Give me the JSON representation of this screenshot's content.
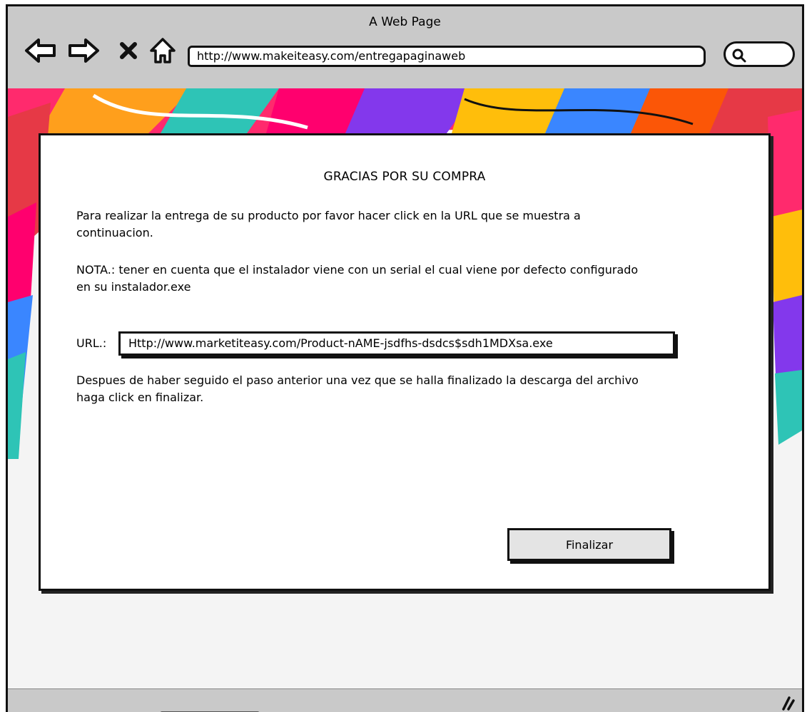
{
  "window": {
    "title": "A Web Page",
    "url": "http://www.makeiteasy.com/entregapaginaweb"
  },
  "icons": {
    "back": "arrow-left-icon",
    "forward": "arrow-right-icon",
    "stop": "close-icon",
    "home": "home-icon",
    "search": "search-icon",
    "resize": "resize-grip-icon"
  },
  "content": {
    "heading": "GRACIAS POR SU COMPRA",
    "paragraph1": "Para realizar la entrega de su producto por favor hacer click en la URL que se muestra a continuacion.",
    "paragraph2": "NOTA.: tener en cuenta que el instalador viene con un serial el cual viene por defecto configurado en su instalador.exe",
    "url_label": "URL.:",
    "download_url": "Http://www.marketiteasy.com/Product-nAME-jsdfhs-dsdcs$sdh1MDXsa.exe",
    "paragraph3": "Despues de haber seguido el paso anterior una vez que se halla finalizado la descarga del archivo haga click en finalizar.",
    "finish_label": "Finalizar"
  },
  "colors": {
    "chrome": "#c9c9c9",
    "button": "#e4e4e4",
    "panel": "#ffffff"
  }
}
